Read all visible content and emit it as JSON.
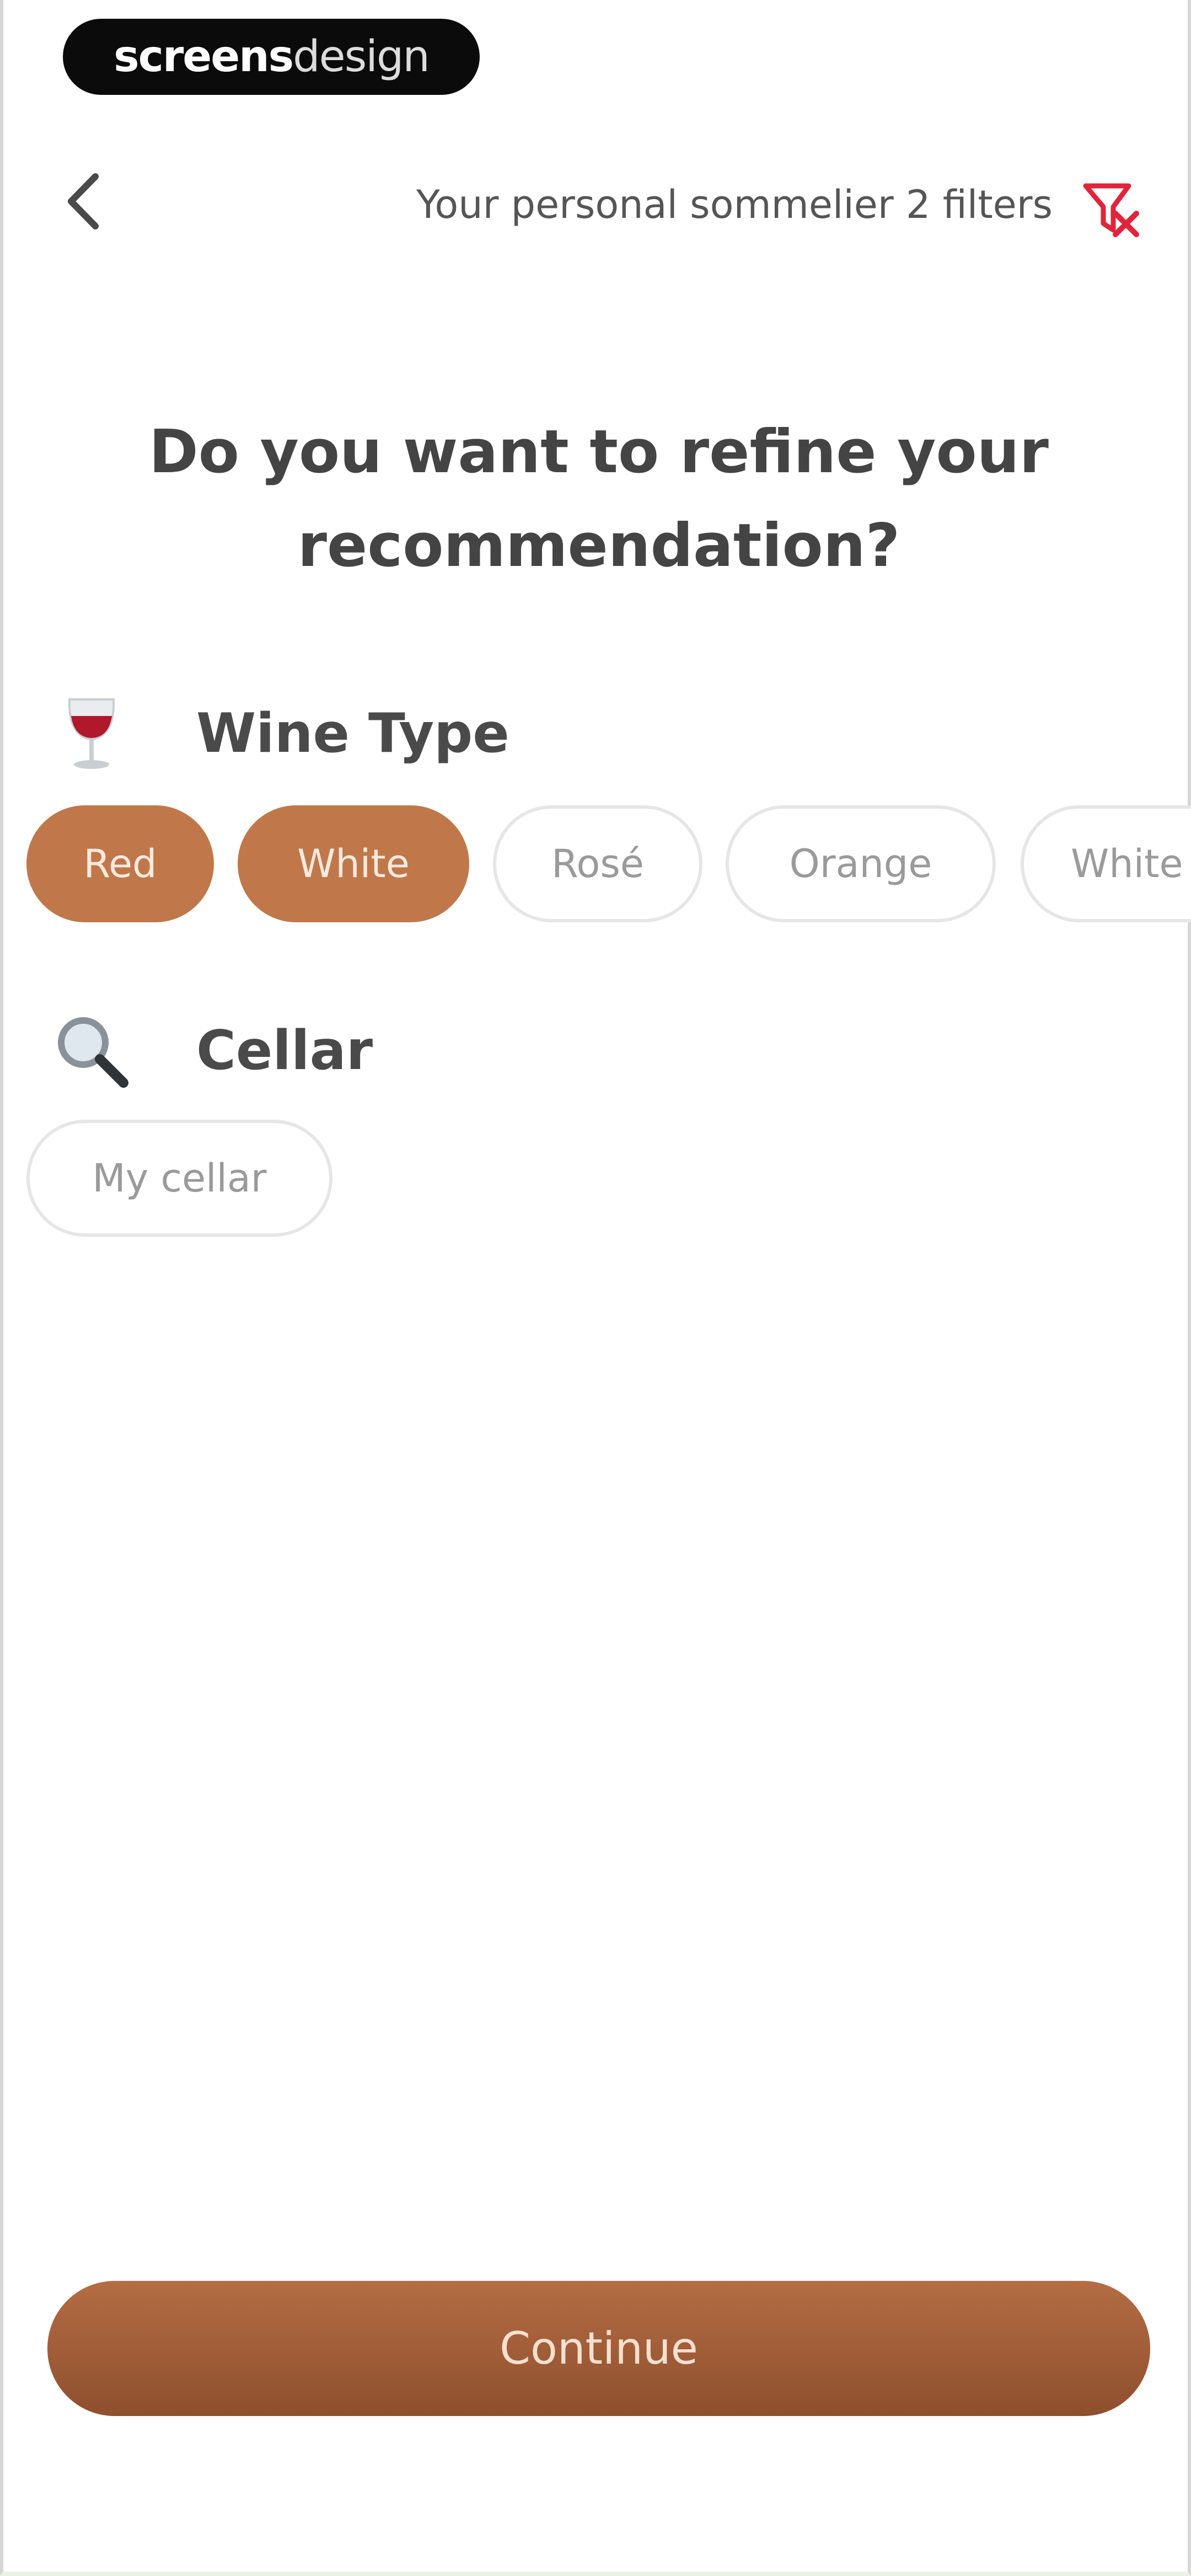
{
  "watermark": {
    "bold": "screens",
    "light": "design"
  },
  "header": {
    "title": "Your personal sommelier 2 filters",
    "back_icon": "chevron-left-icon",
    "filter_icon": "filter-clear-icon",
    "filter_icon_color": "#e0243b"
  },
  "question": "Do you want to refine your recommendation?",
  "wine_type": {
    "heading": "Wine Type",
    "emoji": "wine-glass-icon",
    "options": [
      {
        "label": "Red",
        "selected": true
      },
      {
        "label": "White",
        "selected": true
      },
      {
        "label": "Rosé",
        "selected": false
      },
      {
        "label": "Orange",
        "selected": false
      },
      {
        "label": "White",
        "selected": false
      }
    ]
  },
  "cellar": {
    "heading": "Cellar",
    "emoji": "magnifying-glass-icon",
    "options": [
      {
        "label": "My cellar",
        "selected": false
      }
    ]
  },
  "continue_label": "Continue",
  "colors": {
    "accent": "#c0784a",
    "button_dark": "#8e4f2d",
    "chip_border": "#e6e6e6"
  }
}
